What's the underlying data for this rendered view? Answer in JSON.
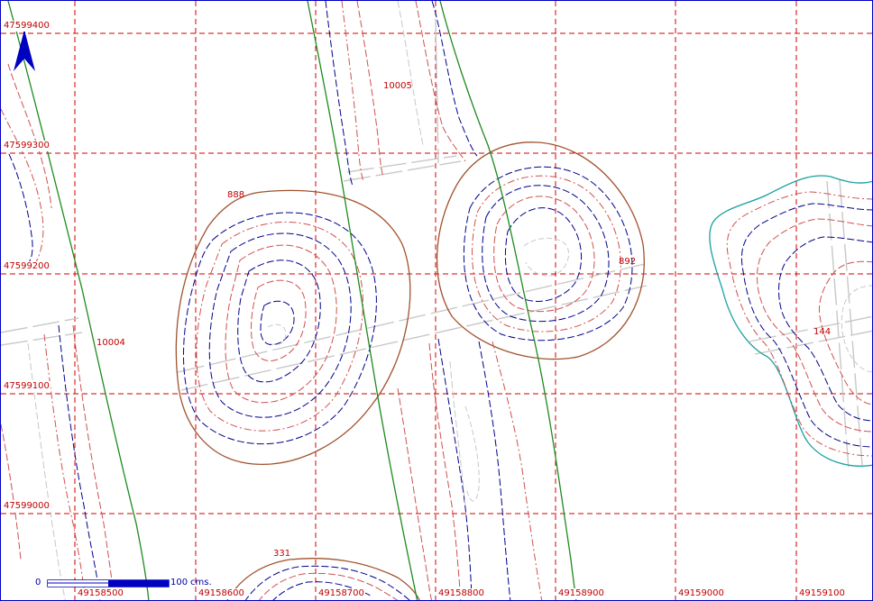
{
  "map": {
    "grid_x_labels": [
      "49158500",
      "49158600",
      "49158700",
      "49158800",
      "49158900",
      "49159000",
      "49159100"
    ],
    "grid_y_labels": [
      "47599400",
      "47599300",
      "47599200",
      "47599100",
      "47599000"
    ],
    "feature_labels": [
      "10005",
      "888",
      "892",
      "10004",
      "144",
      "331"
    ],
    "scale_bar": {
      "start": "0",
      "end": "100",
      "unit": "cms."
    },
    "north_arrow": "north-arrow-icon",
    "colors": {
      "grid": "#d00000",
      "boundary": "#a0522d",
      "road": "#1e8a1e",
      "water": "#1aa0a0",
      "contour_major": "#00008b",
      "contour_minor": "#d05050",
      "track": "#c8c8c8"
    }
  }
}
